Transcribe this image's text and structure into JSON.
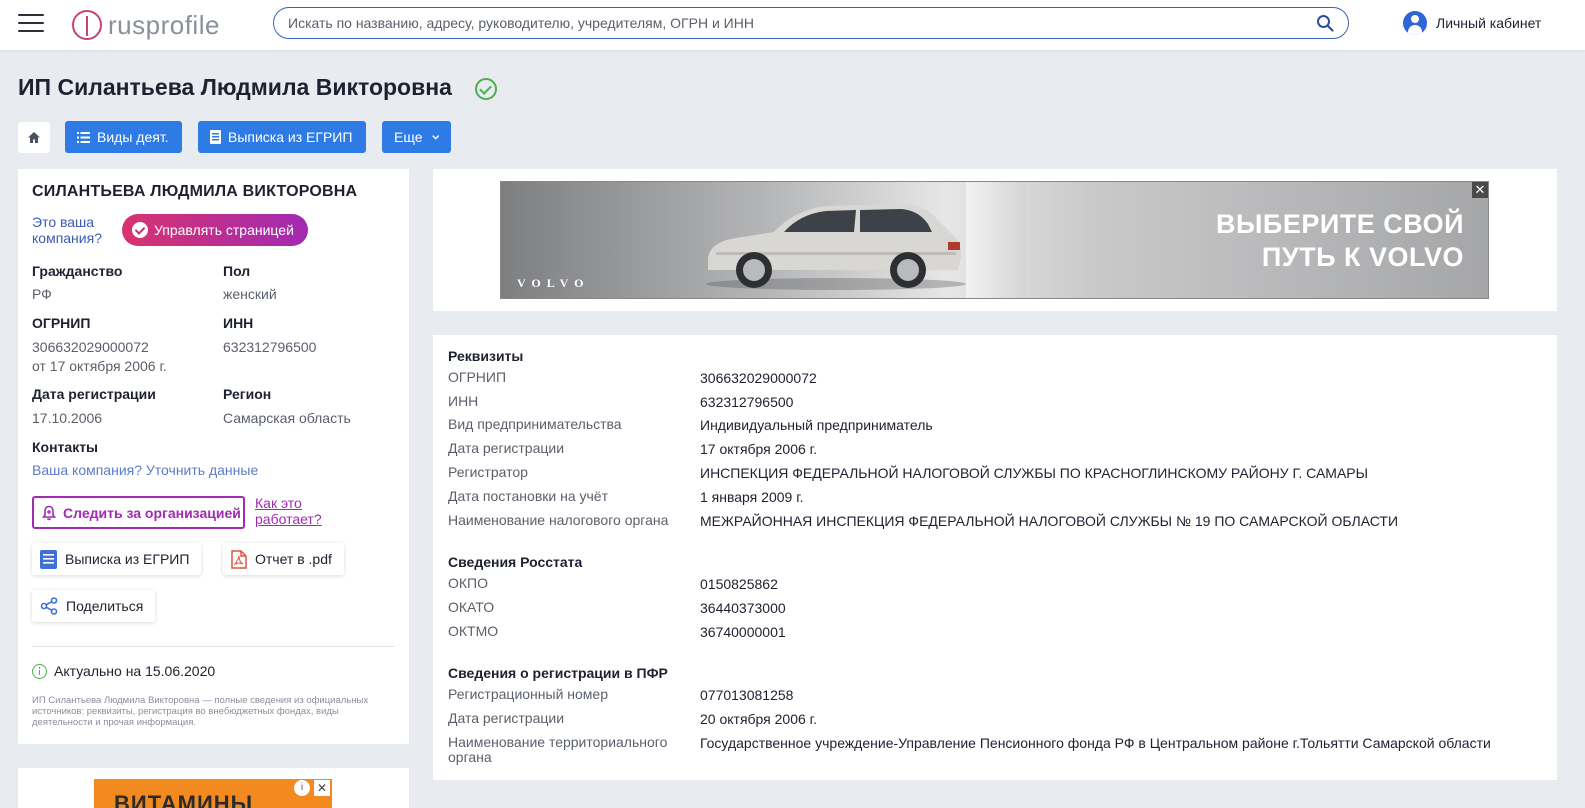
{
  "header": {
    "logo_text": "rusprofile",
    "search_placeholder": "Искать по названию, адресу, руководителю, учредителям, ОГРН и ИНН",
    "account_label": "Личный кабинет"
  },
  "page": {
    "title": "ИП Силантьева Людмила Викторовна"
  },
  "toolbar": {
    "activities_label": "Виды деят.",
    "egrip_label": "Выписка из ЕГРИП",
    "more_label": "Еще"
  },
  "summary": {
    "name": "СИЛАНТЬЕВА ЛЮДМИЛА ВИКТОРОВНА",
    "your_company": "Это ваша компания?",
    "manage_label": "Управлять страницей",
    "citizenship_label": "Гражданство",
    "citizenship_value": "РФ",
    "gender_label": "Пол",
    "gender_value": "женский",
    "ogrnip_label": "ОГРНИП",
    "ogrnip_value": "306632029000072",
    "ogrnip_date": "от 17 октября 2006 г.",
    "inn_label": "ИНН",
    "inn_value": "632312796500",
    "reg_date_label": "Дата регистрации",
    "reg_date_value": "17.10.2006",
    "region_label": "Регион",
    "region_value": "Самарская область",
    "contacts_label": "Контакты",
    "contacts_link": "Ваша компания? Уточнить данные",
    "follow_label": "Следить за организацией",
    "how_label": "Как это работает?",
    "egrip_chip": "Выписка из ЕГРИП",
    "pdf_chip": "Отчет в .pdf",
    "share_chip": "Поделиться",
    "actual": "Актуально на 15.06.2020",
    "disclaimer": "ИП Силантьева Людмила Викторовна — полные сведения из официальных источников: реквизиты, регистрация во внебюджетных фондах, виды деятельности и прочая информация."
  },
  "ad": {
    "slogan_line1": "ВЫБЕРИТЕ СВОЙ",
    "slogan_line2": "ПУТЬ К VOLVO",
    "brand": "VOLVO",
    "close": "✕"
  },
  "ad_small": {
    "text": "ВИТАМИНЫ",
    "info": "i",
    "close": "✕"
  },
  "details": {
    "requisites_title": "Реквизиты",
    "requisites": [
      {
        "label": "ОГРНИП",
        "value": "306632029000072"
      },
      {
        "label": "ИНН",
        "value": "632312796500"
      },
      {
        "label": "Вид предпринимательства",
        "value": "Индивидуальный предприниматель"
      },
      {
        "label": "Дата регистрации",
        "value": "17 октября 2006 г."
      },
      {
        "label": "Регистратор",
        "value": "ИНСПЕКЦИЯ ФЕДЕРАЛЬНОЙ НАЛОГОВОЙ СЛУЖБЫ ПО КРАСНОГЛИНСКОМУ РАЙОНУ Г. САМАРЫ"
      },
      {
        "label": "Дата постановки на учёт",
        "value": "1 января 2009 г."
      },
      {
        "label": "Наименование налогового органа",
        "value": "МЕЖРАЙОННАЯ ИНСПЕКЦИЯ ФЕДЕРАЛЬНОЙ НАЛОГОВОЙ СЛУЖБЫ № 19 ПО САМАРСКОЙ ОБЛАСТИ"
      }
    ],
    "rosstat_title": "Сведения Росстата",
    "rosstat": [
      {
        "label": "ОКПО",
        "value": "0150825862"
      },
      {
        "label": "ОКАТО",
        "value": "36440373000"
      },
      {
        "label": "ОКТМО",
        "value": "36740000001"
      }
    ],
    "pfr_title": "Сведения о регистрации в ПФР",
    "pfr": [
      {
        "label": "Регистрационный номер",
        "value": "077013081258"
      },
      {
        "label": "Дата регистрации",
        "value": "20 октября 2006 г."
      },
      {
        "label": "Наименование территориального органа",
        "value": "Государственное учреждение-Управление Пенсионного фонда РФ в Центральном районе г.Тольятти Самарской области"
      }
    ]
  }
}
